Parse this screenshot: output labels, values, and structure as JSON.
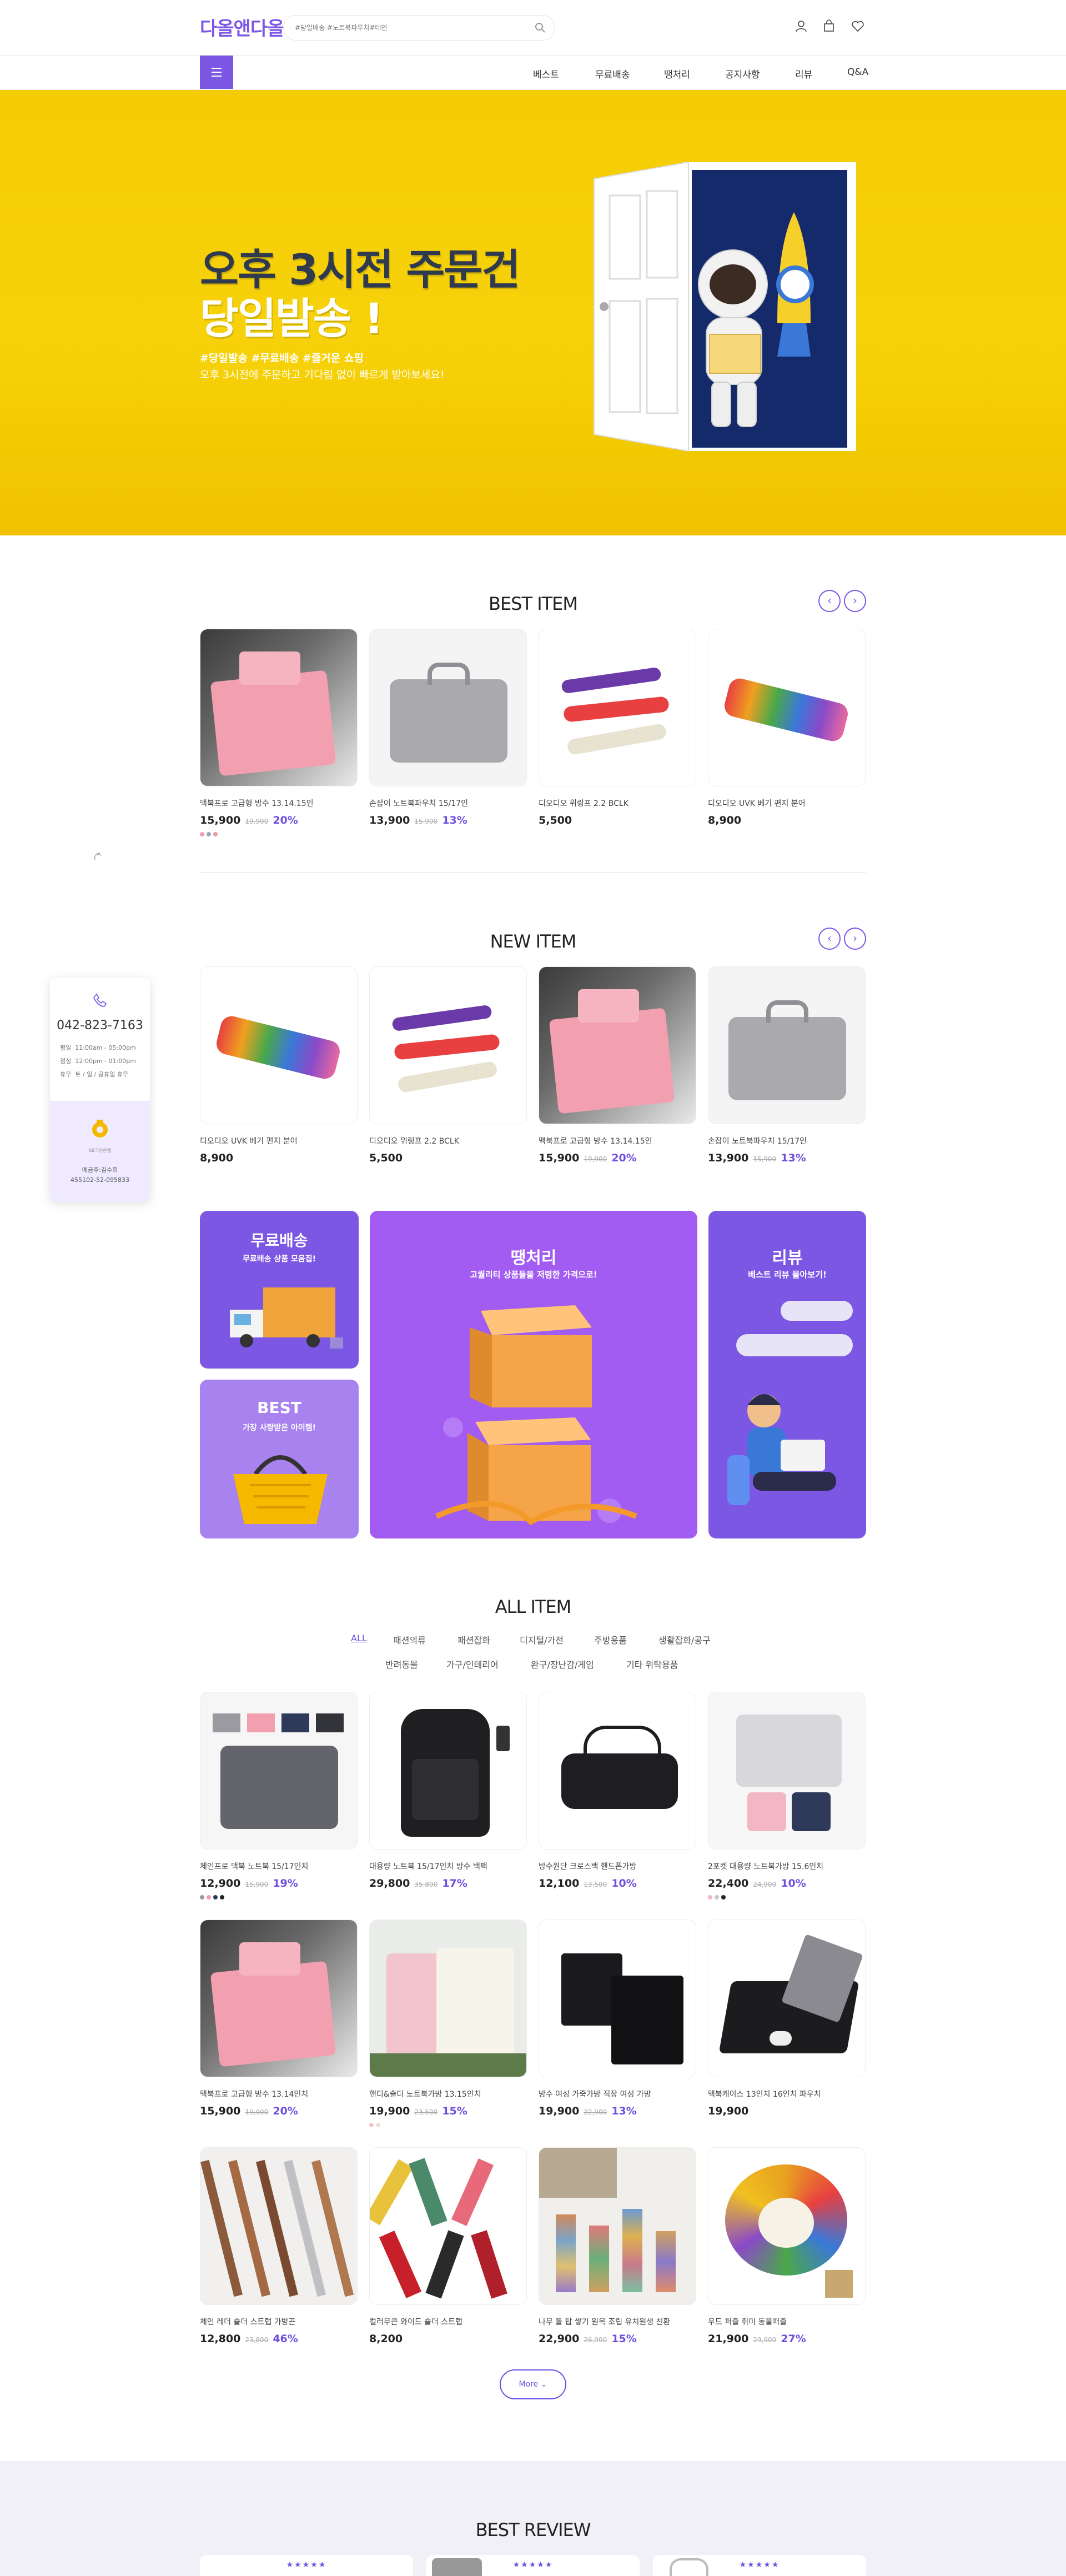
{
  "header": {
    "logo": "다올앤다올",
    "search_placeholder": "#당일배송 #노트북파우치#테인",
    "nav": [
      "베스트",
      "무료배송",
      "땡처리",
      "공지사항",
      "리뷰",
      "Q&A"
    ]
  },
  "hero": {
    "title1": "오후 3시전 주문건",
    "title2": "당일발송 !",
    "sub1": "#당일발송 #무료배송 #즐거운 쇼핑",
    "sub2": "오후 3시전에 주문하고 기다림 없이 빠르게 받아보세요!"
  },
  "best": {
    "title": "BEST ITEM",
    "prev": "‹",
    "next": "›",
    "items": [
      {
        "name": "맥북프로 고급형 방수 13.14.15인",
        "price": "15,900",
        "orig": "19,900",
        "rate": "20%"
      },
      {
        "name": "손잡이 노트북파우치 15/17인",
        "price": "13,900",
        "orig": "15,900",
        "rate": "13%"
      },
      {
        "name": "디오디오 위링프 2.2 BCLK",
        "price": "5,500",
        "orig": "",
        "rate": ""
      },
      {
        "name": "디오디오 UVK 베기 편지 분어",
        "price": "8,900",
        "orig": "",
        "rate": ""
      }
    ]
  },
  "new": {
    "title": "NEW ITEM",
    "prev": "‹",
    "next": "›",
    "items": [
      {
        "name": "디오디오 UVK 베기 편지 분어",
        "price": "8,900",
        "orig": "",
        "rate": ""
      },
      {
        "name": "디오디오 위링프 2.2 BCLK",
        "price": "5,500",
        "orig": "",
        "rate": ""
      },
      {
        "name": "맥북프로 고급형 방수 13.14.15인",
        "price": "15,900",
        "orig": "19,900",
        "rate": "20%"
      },
      {
        "name": "손잡이 노트북파우치 15/17인",
        "price": "13,900",
        "orig": "15,900",
        "rate": "13%"
      }
    ]
  },
  "sidebar": {
    "phone": "042-823-7163",
    "hours": [
      {
        "label": "평일",
        "value": "11:00am - 05:00pm"
      },
      {
        "label": "점심",
        "value": "12:00pm - 01:00pm"
      },
      {
        "label": "휴무",
        "value": "토 / 일 / 공휴일 휴무"
      }
    ],
    "bank_logo": "KB국민은행",
    "bank_owner": "예금주:김수희",
    "bank_account": "455102-52-095833"
  },
  "banners": {
    "free": {
      "title": "무료배송",
      "sub": "무료배송 상품 모음집!"
    },
    "best": {
      "title": "BEST",
      "sub": "가장 사랑받은 아이템!"
    },
    "sale": {
      "title": "땡처리",
      "sub": "고퀄리티 상품들을 저렴한 가격으로!"
    },
    "review": {
      "title": "리뷰",
      "sub": "베스트 리뷰 몰아보기!"
    }
  },
  "all": {
    "title": "ALL ITEM",
    "tabs_row1": [
      "ALL",
      "패션의류",
      "패션잡화",
      "디지털/가전",
      "주방용품",
      "생활잡화/공구"
    ],
    "tabs_row2": [
      "반려동물",
      "가구/인테리어",
      "완구/장난감/게임",
      "기타 위탁용품"
    ],
    "items": [
      {
        "name": "체인프로 맥북 노트북 15/17인치",
        "price": "12,900",
        "orig": "15,900",
        "rate": "19%"
      },
      {
        "name": "대용량 노트북 15/17인치 방수 백팩",
        "price": "29,800",
        "orig": "35,800",
        "rate": "17%"
      },
      {
        "name": "방수원단 크로스백 핸드폰가방",
        "price": "12,100",
        "orig": "13,500",
        "rate": "10%"
      },
      {
        "name": "2포켓 대용량 노트북가방 15.6인치",
        "price": "22,400",
        "orig": "24,900",
        "rate": "10%"
      },
      {
        "name": "맥북프로 고급형 방수 13.14인치",
        "price": "15,900",
        "orig": "19,900",
        "rate": "20%"
      },
      {
        "name": "핸디&숄더 노트북가방 13.15인치",
        "price": "19,900",
        "orig": "23,500",
        "rate": "15%"
      },
      {
        "name": "방수 여성 가죽가방 직장 여성 가방",
        "price": "19,900",
        "orig": "22,900",
        "rate": "13%"
      },
      {
        "name": "맥북케이스 13인치 16인치 파우치",
        "price": "19,900",
        "orig": "",
        "rate": ""
      },
      {
        "name": "체인 레더 숄더 스트랩 가방끈",
        "price": "12,800",
        "orig": "23,800",
        "rate": "46%"
      },
      {
        "name": "컬러무큰 와이드 숄더 스트랩",
        "price": "8,200",
        "orig": "",
        "rate": ""
      },
      {
        "name": "나무 돌 탑 쌓기 원목 조립 유치원생 친환",
        "price": "22,900",
        "orig": "26,900",
        "rate": "15%"
      },
      {
        "name": "우드 퍼즐 취미 동물퍼즐",
        "price": "21,900",
        "orig": "29,900",
        "rate": "27%"
      }
    ],
    "more": "More"
  },
  "review": {
    "title": "BEST REVIEW",
    "stars": "★★★★★"
  },
  "colors": {
    "accent": "#6e4fe0",
    "hero": "#f4cc05"
  }
}
